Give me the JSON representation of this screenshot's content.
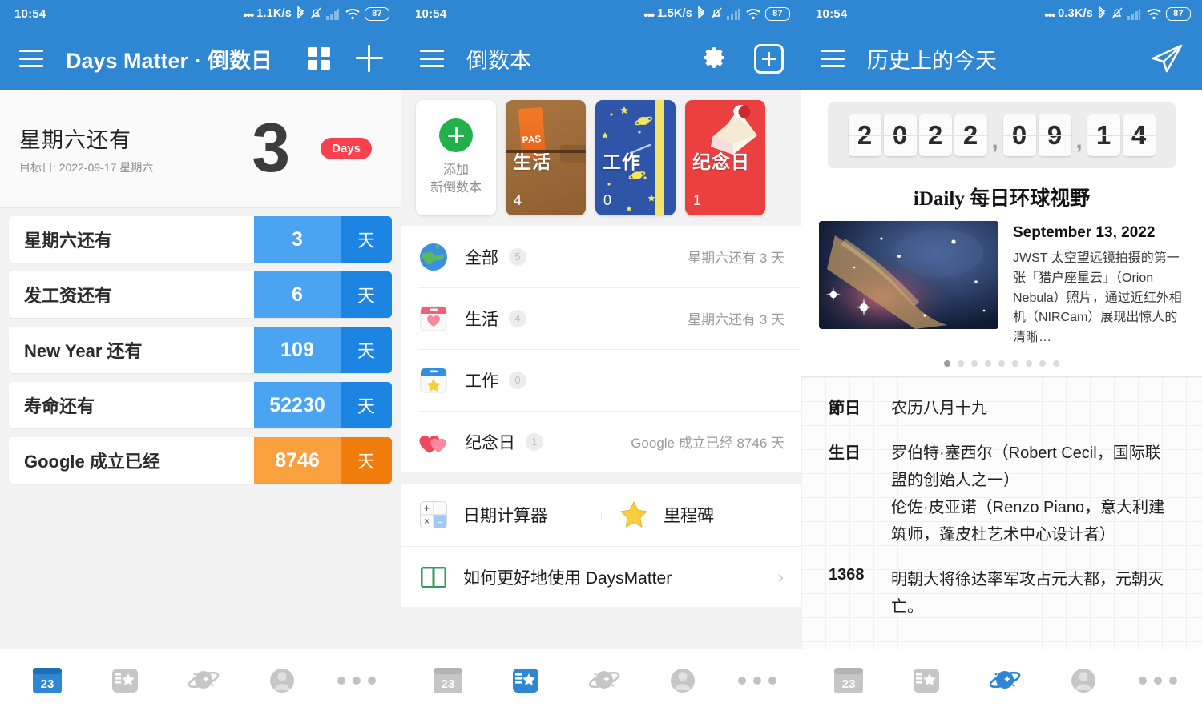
{
  "panels": [
    {
      "statusbar": {
        "time": "10:54",
        "dots": "•••",
        "speed": "1.1K/s",
        "battery": "87"
      },
      "appbar": {
        "title": "Days Matter · 倒数日"
      },
      "hero": {
        "title": "星期六还有",
        "subtitle": "目标日: 2022-09-17 星期六",
        "number": "3",
        "badge": "Days"
      },
      "events": [
        {
          "name": "星期六还有",
          "value": "3",
          "unit": "天",
          "color": "blue"
        },
        {
          "name": "发工资还有",
          "value": "6",
          "unit": "天",
          "color": "blue"
        },
        {
          "name": "New Year 还有",
          "value": "109",
          "unit": "天",
          "color": "blue"
        },
        {
          "name": "寿命还有",
          "value": "52230",
          "unit": "天",
          "color": "blue"
        },
        {
          "name": "Google 成立已经",
          "value": "8746",
          "unit": "天",
          "color": "orange"
        }
      ],
      "bottomnav": {
        "active": "calendar"
      }
    },
    {
      "statusbar": {
        "time": "10:54",
        "dots": "•••",
        "speed": "1.5K/s",
        "battery": "87"
      },
      "appbar": {
        "title": "倒数本"
      },
      "books": [
        {
          "kind": "add",
          "label_line1": "添加",
          "label_line2": "新倒数本"
        },
        {
          "kind": "life",
          "label": "生活",
          "count": "4"
        },
        {
          "kind": "work",
          "label": "工作",
          "count": "0"
        },
        {
          "kind": "anniversary",
          "label": "纪念日",
          "count": "1"
        }
      ],
      "categories": [
        {
          "icon": "globe-icon",
          "name": "全部",
          "badge": "5",
          "right": "星期六还有 3 天"
        },
        {
          "icon": "calendar-heart-icon",
          "name": "生活",
          "badge": "4",
          "right": "星期六还有 3 天"
        },
        {
          "icon": "calendar-star-icon",
          "name": "工作",
          "badge": "0",
          "right": ""
        },
        {
          "icon": "hearts-icon",
          "name": "纪念日",
          "badge": "1",
          "right": "Google 成立已经 8746 天"
        }
      ],
      "tools": [
        {
          "icon": "calculator-icon",
          "label": "日期计算器"
        },
        {
          "icon": "star-icon",
          "label": "里程碑"
        }
      ],
      "help": {
        "icon": "book-icon",
        "label": "如何更好地使用 DaysMatter",
        "chevron": "›"
      },
      "bottomnav": {
        "active": "notebook"
      }
    },
    {
      "statusbar": {
        "time": "10:54",
        "dots": "•••",
        "speed": "0.3K/s",
        "battery": "87"
      },
      "appbar": {
        "title": "历史上的今天"
      },
      "flipdate": {
        "digits": [
          "2",
          "0",
          "2",
          "2",
          ",",
          "0",
          "9",
          ",",
          "1",
          "4"
        ]
      },
      "idaily": {
        "brand": "iDaily 每日环球视野",
        "date": "September 13, 2022",
        "body": "JWST 太空望远镜拍摄的第一张「猎户座星云」（Orion Nebula）照片，通过近红外相机（NIRCam）展现出惊人的清晰…",
        "page_count": 9,
        "active_page": 1
      },
      "history": [
        {
          "key": "節日",
          "value": "农历八月十九"
        },
        {
          "key": "生日",
          "value": "罗伯特·塞西尔（Robert Cecil，国际联盟的创始人之一）\n伦佐·皮亚诺（Renzo Piano，意大利建筑师，蓬皮杜艺术中心设计者）"
        },
        {
          "key": "1368",
          "value": "明朝大将徐达率军攻占元大都，元朝灭亡。"
        }
      ],
      "bottomnav": {
        "active": "discover"
      }
    }
  ],
  "nav_labels": {
    "calendar": "23",
    "notebook": "notebook-star-icon",
    "discover": "planet-icon",
    "profile": "avatar-icon",
    "more": "more-icon"
  },
  "colors": {
    "primary": "#2f86d3",
    "accent_blue_light": "#4aa4f2",
    "accent_blue_dark": "#1c84e3",
    "accent_orange_light": "#f9a03f",
    "accent_orange_dark": "#f07c0b",
    "badge_red": "#f8414f",
    "add_green": "#21b04b"
  }
}
